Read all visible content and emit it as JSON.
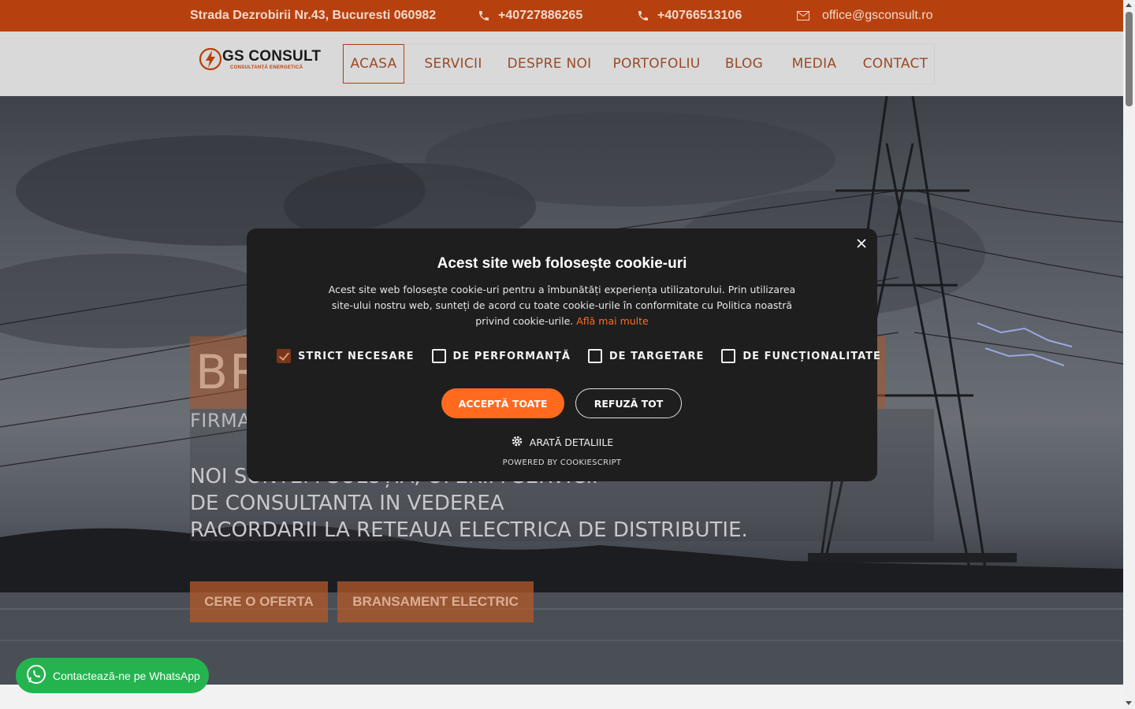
{
  "topbar": {
    "address": "Strada Dezrobirii Nr.43, Bucuresti 060982",
    "phone1": "+40727886265",
    "phone2": "+40766513106",
    "email": "office@gsconsult.ro",
    "icons": [
      "phone-icon",
      "phone-icon",
      "mail-icon"
    ]
  },
  "logo": {
    "name": "GS CONSULT",
    "tagline": "CONSULTANȚĂ ENERGETICĂ"
  },
  "nav": {
    "items": [
      {
        "label": "ACASA",
        "active": true
      },
      {
        "label": "SERVICII"
      },
      {
        "label": "DESPRE NOI"
      },
      {
        "label": "PORTOFOLIU"
      },
      {
        "label": "BLOG"
      },
      {
        "label": "MEDIA"
      },
      {
        "label": "CONTACT"
      }
    ]
  },
  "hero": {
    "title": "BR",
    "subtitle": "FIRMA",
    "description_lines": [
      "NOI SUNTEM SOLUȚIA, OFERIM SERVICII",
      "DE CONSULTANTA IN VEDEREA",
      "RACORDARII LA RETEAUA ELECTRICA DE DISTRIBUTIE."
    ],
    "buttons": [
      "CERE O OFERTA",
      "BRANSAMENT ELECTRIC"
    ]
  },
  "cookie_modal": {
    "title": "Acest site web folosește cookie-uri",
    "body": "Acest site web folosește cookie-uri pentru a îmbunătăți experiența utilizatorului. Prin utilizarea site-ului nostru web, sunteți de acord cu toate cookie-urile în conformitate cu Politica noastră privind cookie-urile.",
    "learn_more": "Află mai multe",
    "checkboxes": [
      {
        "label": "STRICT NECESARE",
        "checked": true
      },
      {
        "label": "DE PERFORMANȚĂ",
        "checked": false
      },
      {
        "label": "DE TARGETARE",
        "checked": false
      },
      {
        "label": "DE FUNCȚIONALITATE",
        "checked": false
      }
    ],
    "accept_label": "ACCEPTĂ TOATE",
    "refuse_label": "REFUZĂ TOT",
    "details_label": "ARATĂ DETALIILE",
    "powered_by": "POWERED BY COOKIESCRIPT"
  },
  "whatsapp": {
    "label": "Contactează-ne pe WhatsApp"
  },
  "colors": {
    "accent": "#b7410e",
    "cookie_accent": "#ff6a1f",
    "whatsapp": "#25b350"
  }
}
